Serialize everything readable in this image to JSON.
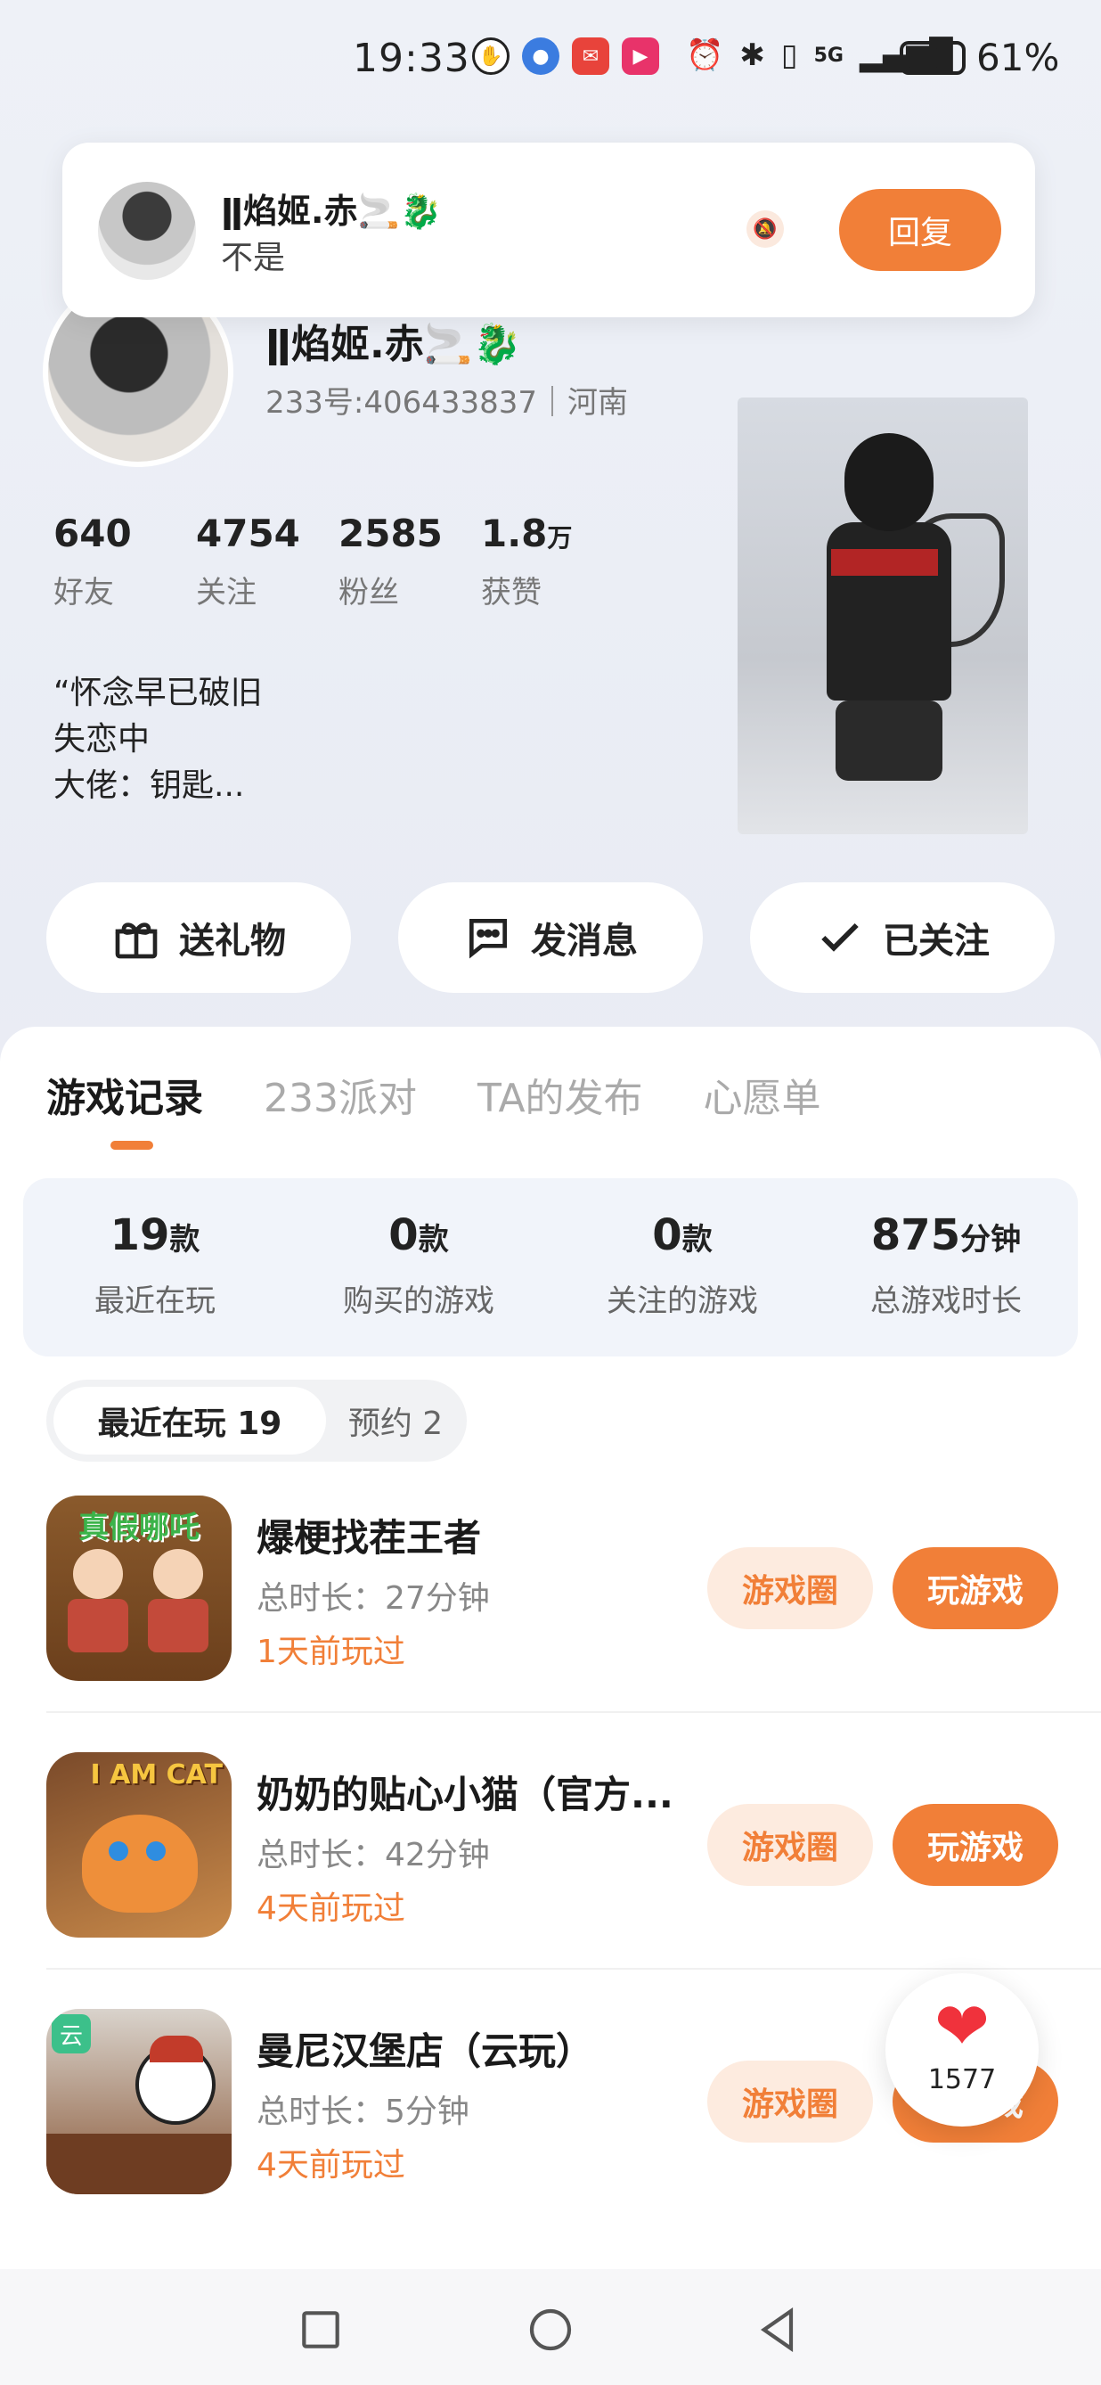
{
  "status_bar": {
    "time": "19:33",
    "network": "5G",
    "battery": "61%",
    "battery_level": 0.61
  },
  "notification": {
    "name": "ǁ焰姬.赤🚬🐉",
    "message": "不是",
    "reply_label": "回复"
  },
  "profile": {
    "name": "ǁ焰姬.赤🚬🐉",
    "id_line": "233号:406433837｜河南",
    "stats": [
      {
        "value": "640",
        "unit": "",
        "label": "好友"
      },
      {
        "value": "4754",
        "unit": "",
        "label": "关注"
      },
      {
        "value": "2585",
        "unit": "",
        "label": "粉丝"
      },
      {
        "value": "1.8",
        "unit": "万",
        "label": "获赞"
      }
    ],
    "bio": [
      "“怀念早已破旧",
      "失恋中",
      "大佬：钥匙..."
    ]
  },
  "actions": {
    "gift": "送礼物",
    "message": "发消息",
    "follow": "已关注"
  },
  "tabs": [
    "游戏记录",
    "233派对",
    "TA的发布",
    "心愿单"
  ],
  "summary": [
    {
      "value": "19",
      "unit": "款",
      "label": "最近在玩"
    },
    {
      "value": "0",
      "unit": "款",
      "label": "购买的游戏"
    },
    {
      "value": "0",
      "unit": "款",
      "label": "关注的游戏"
    },
    {
      "value": "875",
      "unit": "分钟",
      "label": "总游戏时长"
    }
  ],
  "subtabs": {
    "active": "最近在玩 19",
    "other": "预约 2"
  },
  "games": [
    {
      "title": "爆梗找茬王者",
      "duration": "总时长：27分钟",
      "last_played": "1天前玩过",
      "icon_text": "真假哪吒",
      "circle_label": "游戏圈",
      "play_label": "玩游戏"
    },
    {
      "title": "奶奶的贴心小猫（官方...",
      "duration": "总时长：42分钟",
      "last_played": "4天前玩过",
      "icon_text": "I AM CAT",
      "circle_label": "游戏圈",
      "play_label": "玩游戏"
    },
    {
      "title": "曼尼汉堡店（云玩）",
      "duration": "总时长：5分钟",
      "last_played": "4天前玩过",
      "icon_text": "云",
      "circle_label": "游戏圈",
      "play_label": "玩游戏"
    }
  ],
  "like": {
    "count": "1577"
  },
  "colors": {
    "accent": "#f17f38",
    "accent_light": "#fdebdf",
    "heart": "#f0323c"
  }
}
